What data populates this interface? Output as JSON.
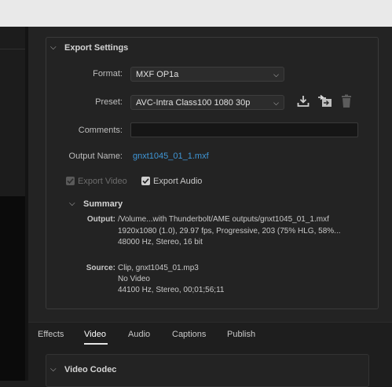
{
  "export_settings": {
    "title": "Export Settings",
    "format_label": "Format:",
    "format_value": "MXF OP1a",
    "preset_label": "Preset:",
    "preset_value": "AVC-Intra Class100 1080 30p",
    "comments_label": "Comments:",
    "comments_value": "",
    "output_name_label": "Output Name:",
    "output_name_value": "gnxt1045_01_1.mxf",
    "export_video_label": "Export Video",
    "export_video_checked": true,
    "export_audio_label": "Export Audio",
    "export_audio_checked": true
  },
  "summary": {
    "title": "Summary",
    "output_label": "Output:",
    "output_lines": [
      "/Volume...with Thunderbolt/AME outputs/gnxt1045_01_1.mxf",
      "1920x1080 (1.0), 29.97 fps, Progressive, 203 (75% HLG, 58%...",
      "48000 Hz, Stereo, 16 bit"
    ],
    "source_label": "Source:",
    "source_lines": [
      "Clip, gnxt1045_01.mp3",
      "No Video",
      "44100 Hz, Stereo, 00;01;56;11"
    ]
  },
  "tabs": [
    "Effects",
    "Video",
    "Audio",
    "Captions",
    "Publish"
  ],
  "active_tab": "Video",
  "video_codec": {
    "title": "Video Codec"
  },
  "colors": {
    "accent_link": "#3f96d6",
    "panel_bg": "#232323",
    "titlebar_bg": "#e9e9e9"
  },
  "icons": [
    "chevron-down-icon",
    "save-preset-icon",
    "import-preset-icon",
    "trash-icon",
    "checkmark-icon"
  ]
}
